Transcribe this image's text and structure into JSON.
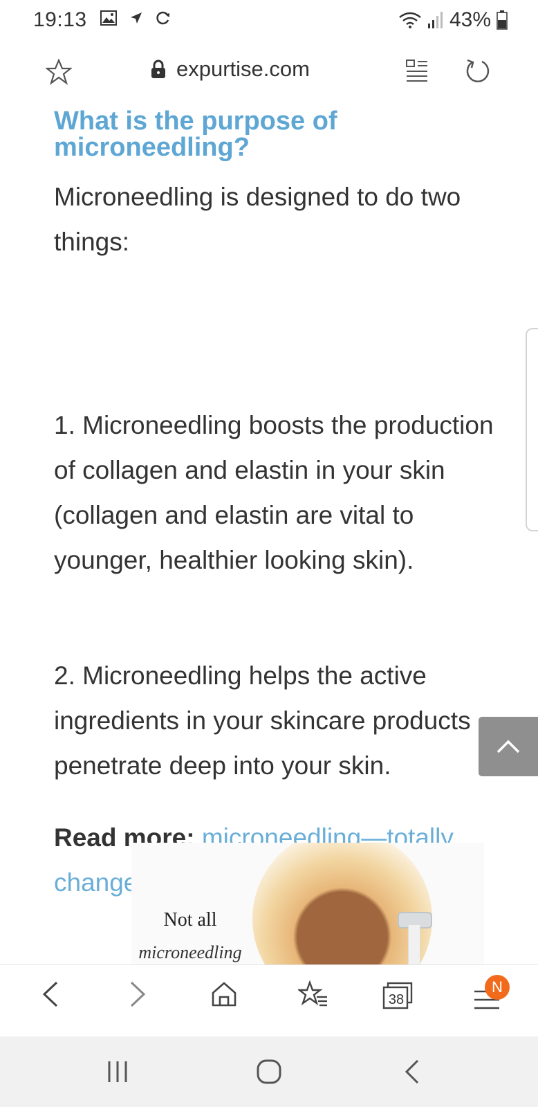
{
  "status_bar": {
    "time": "19:13",
    "battery": "43%",
    "icons": [
      "image-icon",
      "location-arrow-icon",
      "sync-icon",
      "wifi-icon",
      "signal-icon",
      "battery-icon"
    ]
  },
  "url_bar": {
    "domain": "expurtise.com",
    "icons": [
      "star-icon",
      "lock-icon",
      "reader-mode-icon",
      "refresh-icon"
    ]
  },
  "article": {
    "heading": "What is the purpose of microneedling?",
    "intro": "Microneedling is designed to do two things:",
    "point1": "1. Microneedling boosts the production of collagen and elastin in your skin (collagen and elastin are vital to younger, healthier looking skin).",
    "point2": "2. Microneedling helps the active ingredients in your skincare products penetrate deep into your skin.",
    "read_more_label": "Read more:",
    "read_more_link": "microneedling—totally changed my skin!"
  },
  "promo_image": {
    "title": "Not all",
    "subtitle": "microneedling"
  },
  "toolbar": {
    "tab_count": "38",
    "notification_badge": "N",
    "accent_color": "#f26a1b"
  },
  "colors": {
    "heading": "#5ea6d3",
    "link": "#6aaed8",
    "text": "#333333"
  }
}
